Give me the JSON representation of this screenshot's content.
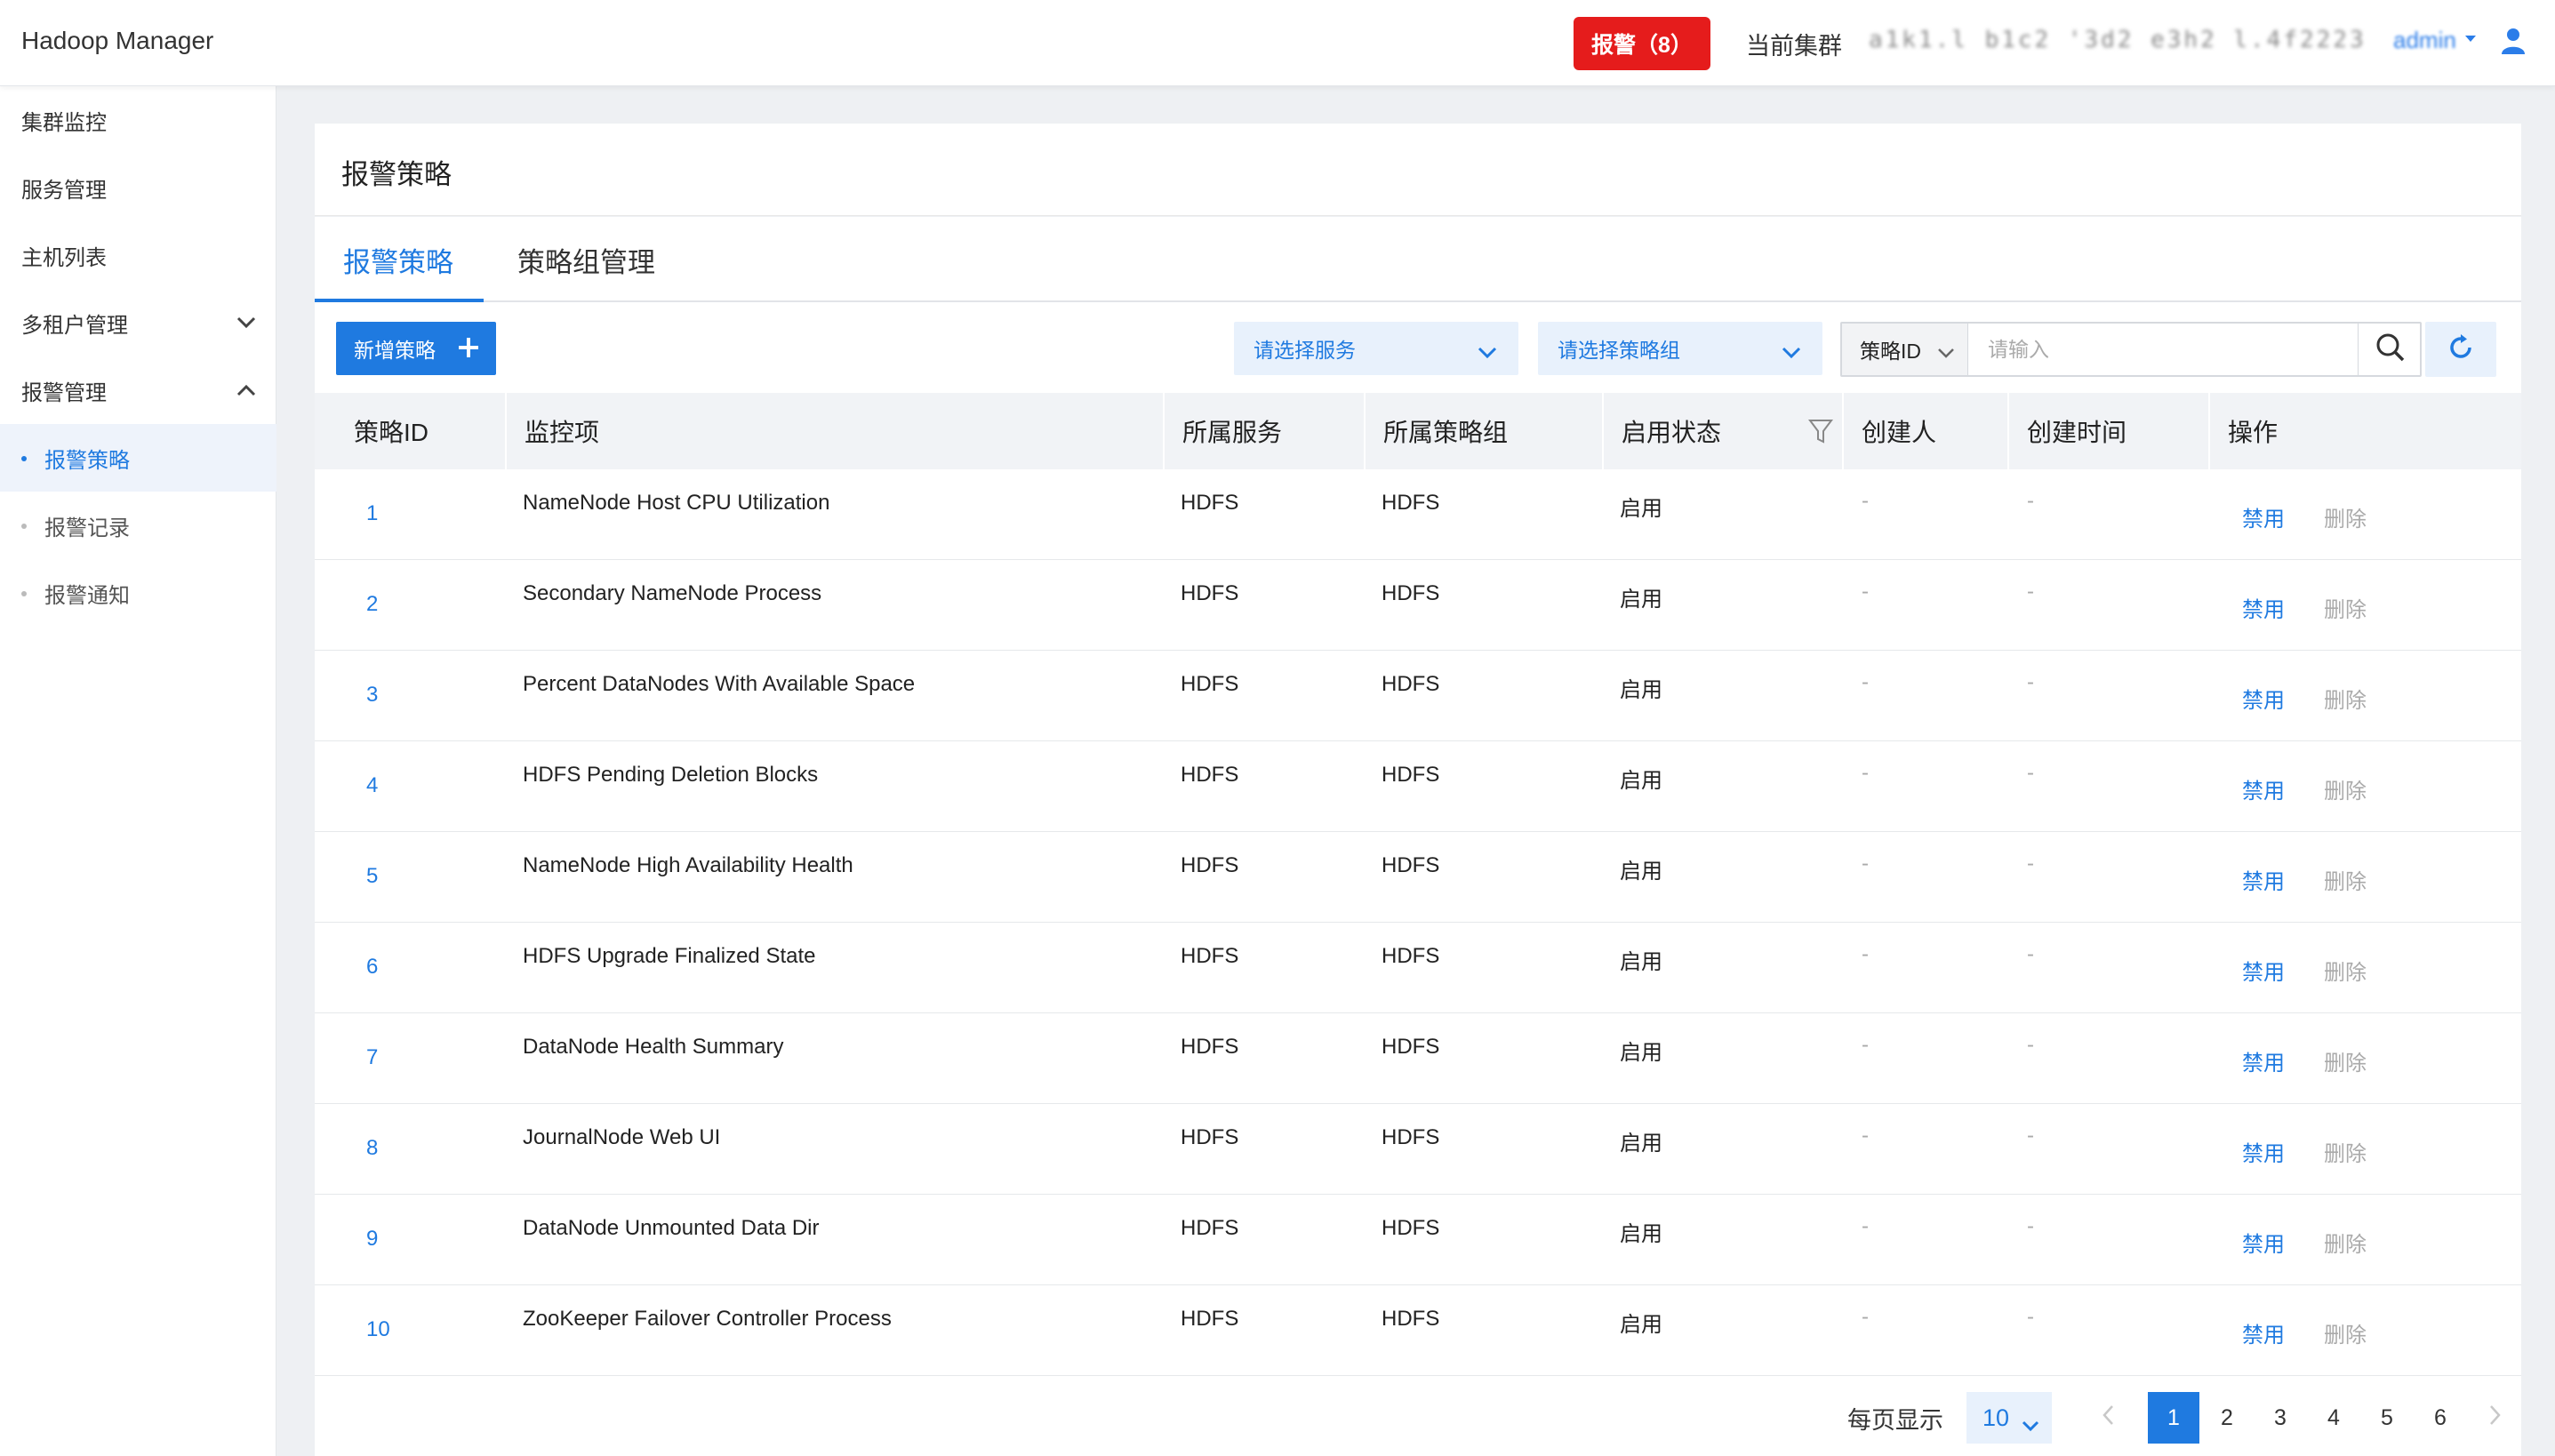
{
  "header": {
    "app_title": "Hadoop Manager",
    "alarm_button": "报警（8）",
    "cluster_label": "当前集群",
    "cluster_name": "a1k1.l b1c2 '3d2 e3h2 l.4f2223.'l4.",
    "user_name": "admin"
  },
  "sidebar": {
    "items": [
      {
        "label": "集群监控"
      },
      {
        "label": "服务管理"
      },
      {
        "label": "主机列表"
      },
      {
        "label": "多租户管理"
      },
      {
        "label": "报警管理"
      }
    ],
    "subitems": [
      {
        "label": "报警策略",
        "active": true
      },
      {
        "label": "报警记录"
      },
      {
        "label": "报警通知"
      }
    ]
  },
  "panel": {
    "title": "报警策略",
    "tabs": [
      {
        "label": "报警策略",
        "active": true
      },
      {
        "label": "策略组管理"
      }
    ]
  },
  "toolbar": {
    "add_label": "新增策略",
    "service_select": "请选择服务",
    "group_select": "请选择策略组",
    "search_type": "策略ID",
    "search_placeholder": "请输入"
  },
  "table": {
    "columns": [
      "策略ID",
      "监控项",
      "所属服务",
      "所属策略组",
      "启用状态",
      "创建人",
      "创建时间",
      "操作"
    ],
    "rows": [
      {
        "id": "1",
        "item": "NameNode Host CPU Utilization",
        "service": "HDFS",
        "group": "HDFS",
        "status": "启用",
        "creator": "-",
        "created": "-",
        "op1": "禁用",
        "op2": "删除"
      },
      {
        "id": "2",
        "item": "Secondary NameNode Process",
        "service": "HDFS",
        "group": "HDFS",
        "status": "启用",
        "creator": "-",
        "created": "-",
        "op1": "禁用",
        "op2": "删除"
      },
      {
        "id": "3",
        "item": "Percent DataNodes With Available Space",
        "service": "HDFS",
        "group": "HDFS",
        "status": "启用",
        "creator": "-",
        "created": "-",
        "op1": "禁用",
        "op2": "删除"
      },
      {
        "id": "4",
        "item": "HDFS Pending Deletion Blocks",
        "service": "HDFS",
        "group": "HDFS",
        "status": "启用",
        "creator": "-",
        "created": "-",
        "op1": "禁用",
        "op2": "删除"
      },
      {
        "id": "5",
        "item": "NameNode High Availability Health",
        "service": "HDFS",
        "group": "HDFS",
        "status": "启用",
        "creator": "-",
        "created": "-",
        "op1": "禁用",
        "op2": "删除"
      },
      {
        "id": "6",
        "item": "HDFS Upgrade Finalized State",
        "service": "HDFS",
        "group": "HDFS",
        "status": "启用",
        "creator": "-",
        "created": "-",
        "op1": "禁用",
        "op2": "删除"
      },
      {
        "id": "7",
        "item": "DataNode Health Summary",
        "service": "HDFS",
        "group": "HDFS",
        "status": "启用",
        "creator": "-",
        "created": "-",
        "op1": "禁用",
        "op2": "删除"
      },
      {
        "id": "8",
        "item": "JournalNode Web UI",
        "service": "HDFS",
        "group": "HDFS",
        "status": "启用",
        "creator": "-",
        "created": "-",
        "op1": "禁用",
        "op2": "删除"
      },
      {
        "id": "9",
        "item": "DataNode Unmounted Data Dir",
        "service": "HDFS",
        "group": "HDFS",
        "status": "启用",
        "creator": "-",
        "created": "-",
        "op1": "禁用",
        "op2": "删除"
      },
      {
        "id": "10",
        "item": "ZooKeeper Failover Controller Process",
        "service": "HDFS",
        "group": "HDFS",
        "status": "启用",
        "creator": "-",
        "created": "-",
        "op1": "禁用",
        "op2": "删除"
      }
    ]
  },
  "pagination": {
    "per_page_label": "每页显示",
    "per_page": "10",
    "pages": [
      "1",
      "2",
      "3",
      "4",
      "5",
      "6"
    ],
    "current": "1"
  },
  "colors": {
    "accent": "#1f7ae0",
    "alarm": "#e51c1c",
    "muted": "#aaaaaa"
  }
}
